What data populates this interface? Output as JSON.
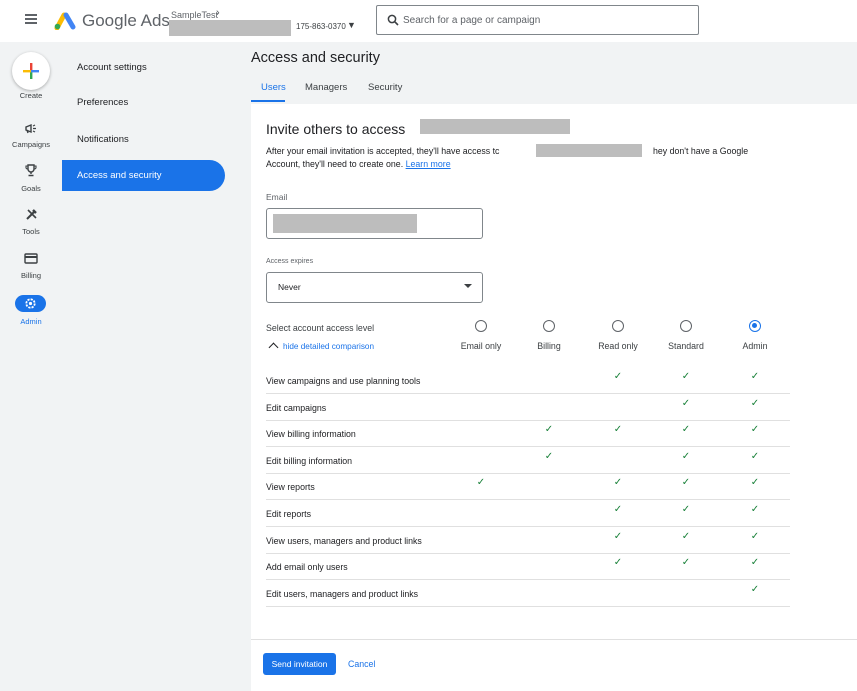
{
  "header": {
    "brand": "Google Ads",
    "account_name": "SampleTest",
    "account_id": "175-863-0370",
    "search_placeholder": "Search for a page or campaign"
  },
  "rail": {
    "create": "Create",
    "campaigns": "Campaigns",
    "goals": "Goals",
    "tools": "Tools",
    "billing": "Billing",
    "admin": "Admin"
  },
  "subnav": [
    {
      "label": "Account settings"
    },
    {
      "label": "Preferences"
    },
    {
      "label": "Notifications"
    },
    {
      "label": "Access and security",
      "active": true
    }
  ],
  "page": {
    "title": "Access and security",
    "tabs": [
      {
        "label": "Users",
        "active": true
      },
      {
        "label": "Managers"
      },
      {
        "label": "Security"
      }
    ]
  },
  "invite": {
    "title": "Invite others to access",
    "desc_part1": "After your email invitation is accepted, they'll have access tc",
    "desc_part2": "hey don't have a Google",
    "desc_line2": "Account, they'll need to create one.",
    "learn_more": "Learn more",
    "email_label": "Email",
    "expires_label": "Access expires",
    "expires_value": "Never",
    "access_level_label": "Select account access level",
    "toggle_label": "hide detailed comparison",
    "levels": [
      {
        "label": "Email only",
        "selected": false
      },
      {
        "label": "Billing",
        "selected": false
      },
      {
        "label": "Read only",
        "selected": false
      },
      {
        "label": "Standard",
        "selected": false
      },
      {
        "label": "Admin",
        "selected": true
      }
    ],
    "permissions": [
      {
        "label": "View campaigns and use planning tools",
        "checks": [
          false,
          false,
          true,
          true,
          true
        ]
      },
      {
        "label": "Edit campaigns",
        "checks": [
          false,
          false,
          false,
          true,
          true
        ]
      },
      {
        "label": "View billing information",
        "checks": [
          false,
          true,
          true,
          true,
          true
        ]
      },
      {
        "label": "Edit billing information",
        "checks": [
          false,
          true,
          false,
          true,
          true
        ]
      },
      {
        "label": "View reports",
        "checks": [
          true,
          false,
          true,
          true,
          true
        ]
      },
      {
        "label": "Edit reports",
        "checks": [
          false,
          false,
          true,
          true,
          true
        ]
      },
      {
        "label": "View users, managers and product links",
        "checks": [
          false,
          false,
          true,
          true,
          true
        ]
      },
      {
        "label": "Add email only users",
        "checks": [
          false,
          false,
          true,
          true,
          true
        ]
      },
      {
        "label": "Edit users, managers and product links",
        "checks": [
          false,
          false,
          false,
          false,
          true
        ]
      }
    ],
    "check_glyph": "✓",
    "send_label": "Send invitation",
    "cancel_label": "Cancel"
  },
  "colors": {
    "accent": "#1a73e8",
    "check": "#188038",
    "redaction": "#bdbdbd"
  }
}
